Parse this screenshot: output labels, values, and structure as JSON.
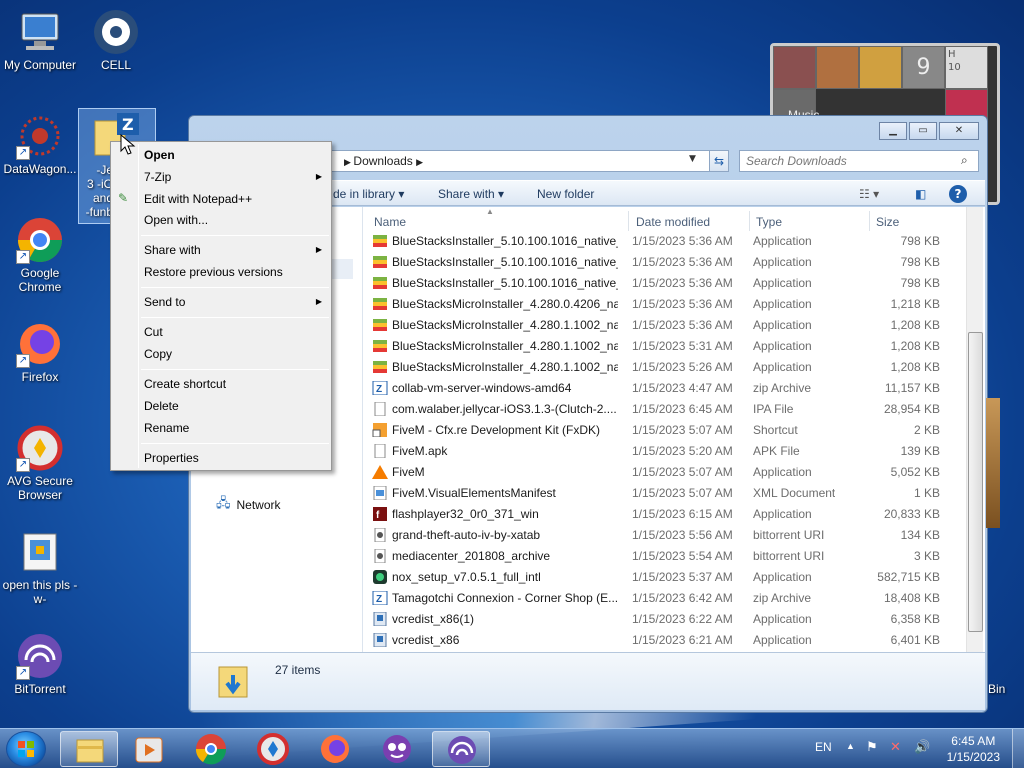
{
  "desktop": {
    "icons": [
      {
        "label": "My Computer"
      },
      {
        "label": "CELL"
      },
      {
        "label": "DataWagon..."
      },
      {
        "label": "Google Chrome"
      },
      {
        "label": "Firefox"
      },
      {
        "label": "AVG Secure Browser"
      },
      {
        "label": "open this pls -w-"
      },
      {
        "label": "BitTorrent"
      }
    ],
    "selected_icon_label": "-Je\n3 -iO\nand\n-funb",
    "right_edge_label": "Bin"
  },
  "gadget": {
    "label": "Music",
    "clock_text": "9",
    "h_label": "H",
    "num": "10"
  },
  "explorer": {
    "address": "Downloads",
    "search_placeholder": "Search Downloads",
    "toolbar": {
      "include_library": "de in library",
      "share_with": "Share with",
      "new_folder": "New folder"
    },
    "nav": {
      "network": "Network"
    },
    "columns": {
      "name": "Name",
      "date": "Date modified",
      "type": "Type",
      "size": "Size"
    },
    "files": [
      {
        "name": "BlueStacksInstaller_5.10.100.1016_native_...",
        "date": "1/15/2023 5:36 AM",
        "type": "Application",
        "size": "798 KB",
        "icon": "bluestacks-icon"
      },
      {
        "name": "BlueStacksInstaller_5.10.100.1016_native_...",
        "date": "1/15/2023 5:36 AM",
        "type": "Application",
        "size": "798 KB",
        "icon": "bluestacks-icon"
      },
      {
        "name": "BlueStacksInstaller_5.10.100.1016_native_...",
        "date": "1/15/2023 5:36 AM",
        "type": "Application",
        "size": "798 KB",
        "icon": "bluestacks-icon"
      },
      {
        "name": "BlueStacksMicroInstaller_4.280.0.4206_na...",
        "date": "1/15/2023 5:36 AM",
        "type": "Application",
        "size": "1,218 KB",
        "icon": "bluestacks-icon"
      },
      {
        "name": "BlueStacksMicroInstaller_4.280.1.1002_na...",
        "date": "1/15/2023 5:36 AM",
        "type": "Application",
        "size": "1,208 KB",
        "icon": "bluestacks-icon"
      },
      {
        "name": "BlueStacksMicroInstaller_4.280.1.1002_na...",
        "date": "1/15/2023 5:31 AM",
        "type": "Application",
        "size": "1,208 KB",
        "icon": "bluestacks-icon"
      },
      {
        "name": "BlueStacksMicroInstaller_4.280.1.1002_na...",
        "date": "1/15/2023 5:26 AM",
        "type": "Application",
        "size": "1,208 KB",
        "icon": "bluestacks-icon"
      },
      {
        "name": "collab-vm-server-windows-amd64",
        "date": "1/15/2023 4:47 AM",
        "type": "zip Archive",
        "size": "11,157 KB",
        "icon": "zip-icon"
      },
      {
        "name": "com.walaber.jellycar-iOS3.1.3-(Clutch-2....",
        "date": "1/15/2023 6:45 AM",
        "type": "IPA File",
        "size": "28,954 KB",
        "icon": "file-icon"
      },
      {
        "name": "FiveM - Cfx.re Development Kit (FxDK)",
        "date": "1/15/2023 5:07 AM",
        "type": "Shortcut",
        "size": "2 KB",
        "icon": "shortcut-icon"
      },
      {
        "name": "FiveM.apk",
        "date": "1/15/2023 5:20 AM",
        "type": "APK File",
        "size": "139 KB",
        "icon": "file-icon"
      },
      {
        "name": "FiveM",
        "date": "1/15/2023 5:07 AM",
        "type": "Application",
        "size": "5,052 KB",
        "icon": "fivem-icon"
      },
      {
        "name": "FiveM.VisualElementsManifest",
        "date": "1/15/2023 5:07 AM",
        "type": "XML Document",
        "size": "1 KB",
        "icon": "xml-icon"
      },
      {
        "name": "flashplayer32_0r0_371_win",
        "date": "1/15/2023 6:15 AM",
        "type": "Application",
        "size": "20,833 KB",
        "icon": "flash-icon"
      },
      {
        "name": "grand-theft-auto-iv-by-xatab",
        "date": "1/15/2023 5:56 AM",
        "type": "bittorrent URI",
        "size": "134 KB",
        "icon": "torrent-icon"
      },
      {
        "name": "mediacenter_201808_archive",
        "date": "1/15/2023 5:54 AM",
        "type": "bittorrent URI",
        "size": "3 KB",
        "icon": "torrent-icon"
      },
      {
        "name": "nox_setup_v7.0.5.1_full_intl",
        "date": "1/15/2023 5:37 AM",
        "type": "Application",
        "size": "582,715 KB",
        "icon": "nox-icon"
      },
      {
        "name": "Tamagotchi Connexion - Corner Shop (E...",
        "date": "1/15/2023 6:42 AM",
        "type": "zip Archive",
        "size": "18,408 KB",
        "icon": "zip-icon"
      },
      {
        "name": "vcredist_x86(1)",
        "date": "1/15/2023 6:22 AM",
        "type": "Application",
        "size": "6,358 KB",
        "icon": "installer-icon"
      },
      {
        "name": "vcredist_x86",
        "date": "1/15/2023 6:21 AM",
        "type": "Application",
        "size": "6,401 KB",
        "icon": "installer-icon"
      }
    ],
    "status": {
      "items": "27 items"
    }
  },
  "context_menu": {
    "items": [
      {
        "label": "Open",
        "bold": true
      },
      {
        "label": "7-Zip",
        "submenu": true
      },
      {
        "label": "Edit with Notepad++"
      },
      {
        "label": "Open with..."
      },
      {
        "label": "Share with",
        "submenu": true
      },
      {
        "label": "Restore previous versions"
      },
      {
        "label": "Send to",
        "submenu": true
      },
      {
        "label": "Cut"
      },
      {
        "label": "Copy"
      },
      {
        "label": "Create shortcut"
      },
      {
        "label": "Delete"
      },
      {
        "label": "Rename"
      },
      {
        "label": "Properties"
      }
    ]
  },
  "taskbar": {
    "language": "EN",
    "time": "6:45 AM",
    "date": "1/15/2023",
    "apps": [
      "explorer-icon",
      "media-player-icon",
      "chrome-icon",
      "avg-browser-icon",
      "firefox-icon",
      "bonzi-icon",
      "bittorrent-icon"
    ]
  },
  "colors": {
    "accent": "#1c5fb5",
    "menu_bg": "#f0f0f0",
    "window_frame": "#bcd3ec"
  }
}
